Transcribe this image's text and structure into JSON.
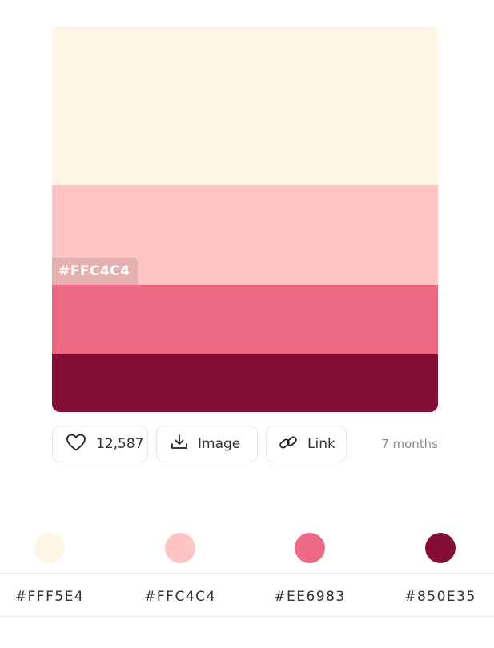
{
  "palette": {
    "colors": [
      "#FFF5E4",
      "#FFC4C4",
      "#EE6983",
      "#850E35"
    ],
    "hover_hex_label": "#FFC4C4"
  },
  "actions": {
    "likes": "12,587",
    "image_label": "Image",
    "link_label": "Link",
    "age": "7 months"
  },
  "icons": {
    "like": "heart-icon",
    "image": "download-icon",
    "link": "link-icon"
  },
  "codes": [
    "#FFF5E4",
    "#FFC4C4",
    "#EE6983",
    "#850E35"
  ]
}
